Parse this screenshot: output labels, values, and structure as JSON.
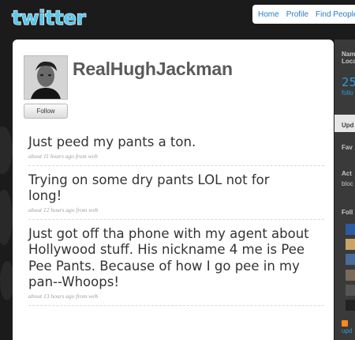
{
  "header": {
    "logo_text": "twitter",
    "nav": [
      {
        "label": "Home"
      },
      {
        "label": "Profile"
      },
      {
        "label": "Find People"
      }
    ]
  },
  "profile": {
    "username": "RealHughJackman",
    "follow_label": "Follow"
  },
  "tweets": [
    {
      "text": "Just peed my pants a ton.",
      "meta": "about 11 hours ago from web"
    },
    {
      "text": "Trying on some dry pants LOL not for long!",
      "meta": "about 12 hours ago from web"
    },
    {
      "text": "Just got off tha phone with my agent about Hollywood stuff. His nickname 4 me is Pee Pee Pants. Because of how I go pee in my pan--Whoops!",
      "meta": "about 13 hours ago from web"
    }
  ],
  "sidebar": {
    "name_label": "Nam",
    "location_label": "Loca",
    "count": "25",
    "count_label": "follo",
    "updates_tab": "Upd",
    "favorites": "Fav",
    "actions": "Act",
    "actions_sub": "bloc",
    "following": "Foll",
    "rss_label": "upd"
  },
  "colors": {
    "background": "#1b1b1b",
    "link": "#2a7cc5",
    "logo": "#59c6ec"
  }
}
